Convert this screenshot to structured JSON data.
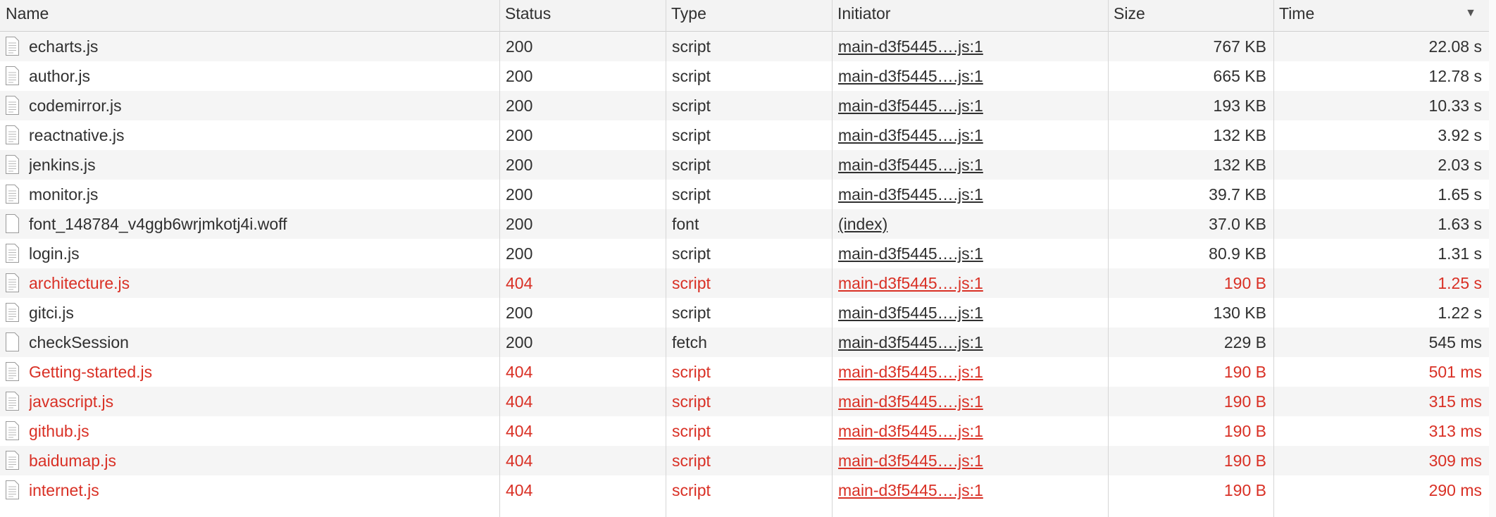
{
  "columns": {
    "name": "Name",
    "status": "Status",
    "type": "Type",
    "initiator": "Initiator",
    "size": "Size",
    "time": "Time"
  },
  "sort_indicator": "▼",
  "colors": {
    "error": "#d93025",
    "text": "#303030",
    "stripe": "#f5f5f5"
  },
  "rows": [
    {
      "name": "echarts.js",
      "status": "200",
      "type": "script",
      "initiator": "main-d3f5445….js:1",
      "size": "767 KB",
      "time": "22.08 s",
      "icon": "script-file-icon",
      "error": false
    },
    {
      "name": "author.js",
      "status": "200",
      "type": "script",
      "initiator": "main-d3f5445….js:1",
      "size": "665 KB",
      "time": "12.78 s",
      "icon": "script-file-icon",
      "error": false
    },
    {
      "name": "codemirror.js",
      "status": "200",
      "type": "script",
      "initiator": "main-d3f5445….js:1",
      "size": "193 KB",
      "time": "10.33 s",
      "icon": "script-file-icon",
      "error": false
    },
    {
      "name": "reactnative.js",
      "status": "200",
      "type": "script",
      "initiator": "main-d3f5445….js:1",
      "size": "132 KB",
      "time": "3.92 s",
      "icon": "script-file-icon",
      "error": false
    },
    {
      "name": "jenkins.js",
      "status": "200",
      "type": "script",
      "initiator": "main-d3f5445….js:1",
      "size": "132 KB",
      "time": "2.03 s",
      "icon": "script-file-icon",
      "error": false
    },
    {
      "name": "monitor.js",
      "status": "200",
      "type": "script",
      "initiator": "main-d3f5445….js:1",
      "size": "39.7 KB",
      "time": "1.65 s",
      "icon": "script-file-icon",
      "error": false
    },
    {
      "name": "font_148784_v4ggb6wrjmkotj4i.woff",
      "status": "200",
      "type": "font",
      "initiator": "(index)",
      "size": "37.0 KB",
      "time": "1.63 s",
      "icon": "blank-file-icon",
      "error": false
    },
    {
      "name": "login.js",
      "status": "200",
      "type": "script",
      "initiator": "main-d3f5445….js:1",
      "size": "80.9 KB",
      "time": "1.31 s",
      "icon": "script-file-icon",
      "error": false
    },
    {
      "name": "architecture.js",
      "status": "404",
      "type": "script",
      "initiator": "main-d3f5445….js:1",
      "size": "190 B",
      "time": "1.25 s",
      "icon": "script-file-icon",
      "error": true
    },
    {
      "name": "gitci.js",
      "status": "200",
      "type": "script",
      "initiator": "main-d3f5445….js:1",
      "size": "130 KB",
      "time": "1.22 s",
      "icon": "script-file-icon",
      "error": false
    },
    {
      "name": "checkSession",
      "status": "200",
      "type": "fetch",
      "initiator": "main-d3f5445….js:1",
      "size": "229 B",
      "time": "545 ms",
      "icon": "blank-file-icon",
      "error": false
    },
    {
      "name": "Getting-started.js",
      "status": "404",
      "type": "script",
      "initiator": "main-d3f5445….js:1",
      "size": "190 B",
      "time": "501 ms",
      "icon": "script-file-icon",
      "error": true
    },
    {
      "name": "javascript.js",
      "status": "404",
      "type": "script",
      "initiator": "main-d3f5445….js:1",
      "size": "190 B",
      "time": "315 ms",
      "icon": "script-file-icon",
      "error": true
    },
    {
      "name": "github.js",
      "status": "404",
      "type": "script",
      "initiator": "main-d3f5445….js:1",
      "size": "190 B",
      "time": "313 ms",
      "icon": "script-file-icon",
      "error": true
    },
    {
      "name": "baidumap.js",
      "status": "404",
      "type": "script",
      "initiator": "main-d3f5445….js:1",
      "size": "190 B",
      "time": "309 ms",
      "icon": "script-file-icon",
      "error": true
    },
    {
      "name": "internet.js",
      "status": "404",
      "type": "script",
      "initiator": "main-d3f5445….js:1",
      "size": "190 B",
      "time": "290 ms",
      "icon": "script-file-icon",
      "error": true
    }
  ]
}
